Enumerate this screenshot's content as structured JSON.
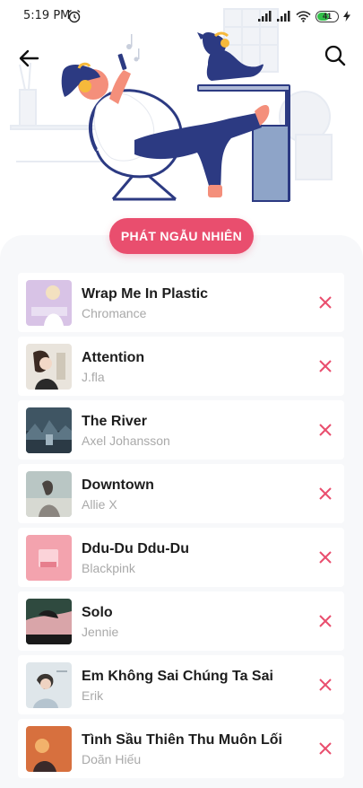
{
  "status_bar": {
    "time": "5:19 PM",
    "battery": "41"
  },
  "header": {
    "back_icon": "arrow-left-icon",
    "search_icon": "search-icon"
  },
  "shuffle_button": {
    "label": "PHÁT NGẪU NHIÊN"
  },
  "colors": {
    "accent": "#e94e6e",
    "panel": "#f7f8fa",
    "title": "#1d1d1d",
    "subtitle": "#a9a9a9"
  },
  "songs": [
    {
      "title": "Wrap Me In Plastic",
      "artist": "Chromance"
    },
    {
      "title": "Attention",
      "artist": "J.fla"
    },
    {
      "title": "The River",
      "artist": "Axel Johansson"
    },
    {
      "title": "Downtown",
      "artist": "Allie X"
    },
    {
      "title": "Ddu-Du Ddu-Du",
      "artist": "Blackpink"
    },
    {
      "title": "Solo",
      "artist": "Jennie"
    },
    {
      "title": "Em Không Sai Chúng Ta Sai",
      "artist": "Erik"
    },
    {
      "title": "Tình Sầu Thiên Thu Muôn Lối",
      "artist": "Doãn Hiếu"
    }
  ]
}
